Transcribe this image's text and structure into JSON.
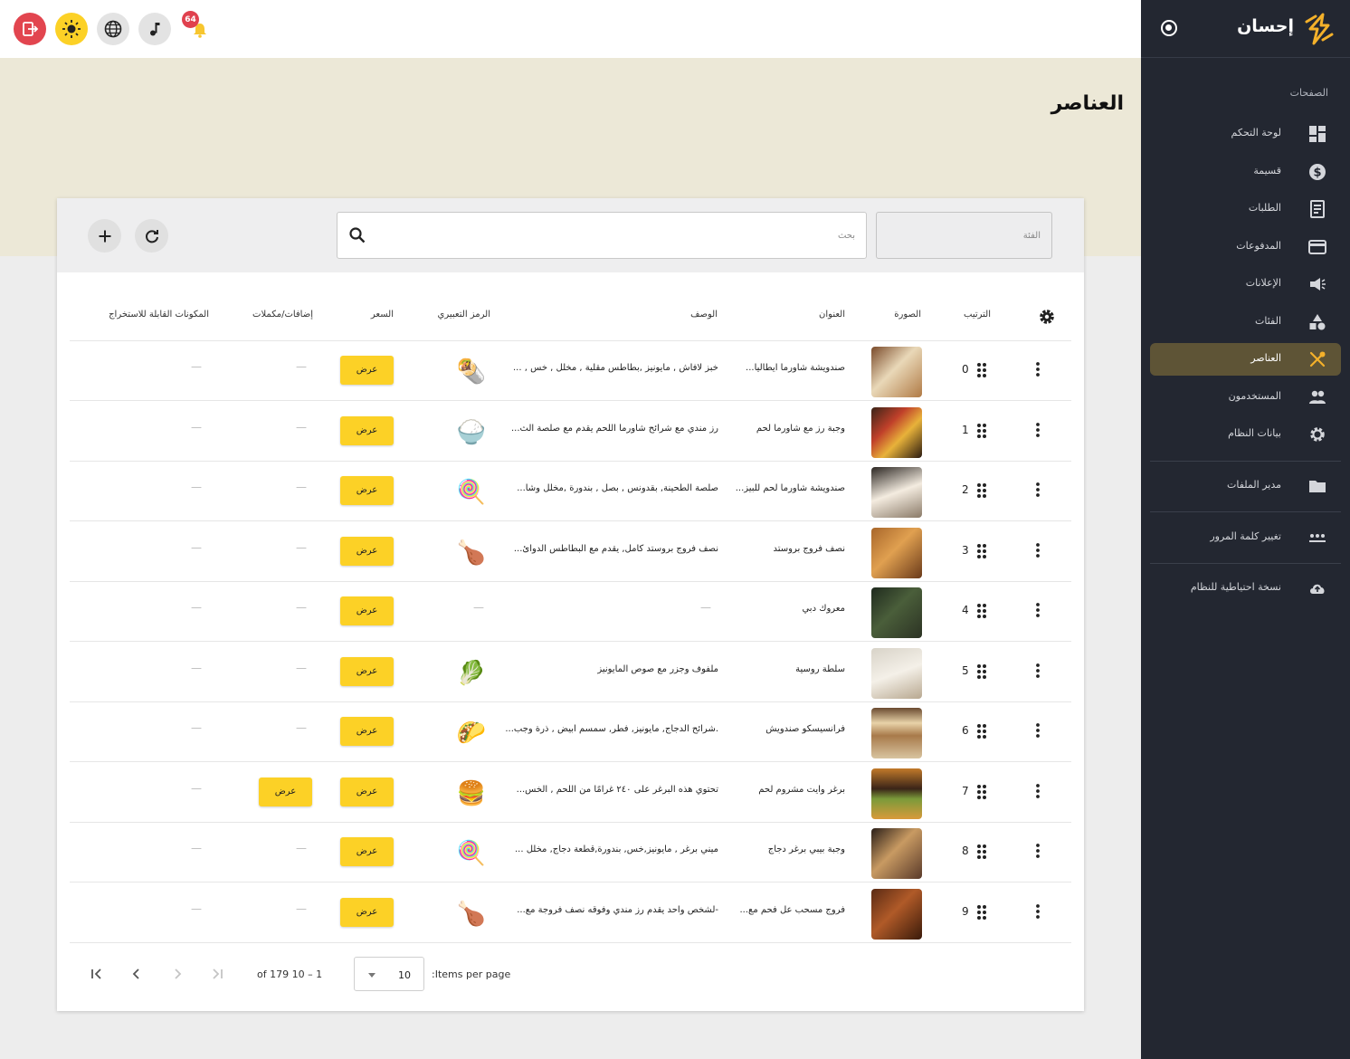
{
  "app": {
    "name": "إحسان"
  },
  "topbar": {
    "notification_count": "64",
    "buttons": [
      "logout-icon",
      "sun-icon",
      "globe-icon",
      "music-note-icon",
      "bell-icon"
    ]
  },
  "sidebar": {
    "section_title": "الصفحات",
    "items": [
      {
        "label": "لوحة التحكم",
        "icon": "dashboard-icon"
      },
      {
        "label": "قسيمة",
        "icon": "dollar-icon"
      },
      {
        "label": "الطلبات",
        "icon": "receipt-icon"
      },
      {
        "label": "المدفوعات",
        "icon": "credit-card-icon"
      },
      {
        "label": "الإعلانات",
        "icon": "megaphone-icon"
      },
      {
        "label": "الفئات",
        "icon": "category-icon"
      },
      {
        "label": "العناصر",
        "icon": "utensils-icon",
        "active": true
      },
      {
        "label": "المستخدمون",
        "icon": "users-icon"
      },
      {
        "label": "بيانات النظام",
        "icon": "gear-icon"
      }
    ],
    "file_manager": "مدير الملفات",
    "change_password": "تغيير كلمة المرور",
    "backup": "نسخة احتياطية للنظام"
  },
  "page": {
    "title": "العناصر"
  },
  "filters": {
    "search_placeholder": "بحث",
    "category_placeholder": "الفئة"
  },
  "table": {
    "headers": {
      "order": "الترتيب",
      "image": "الصورة",
      "title": "العنوان",
      "description": "الوصف",
      "emoji": "الرمز التعبيري",
      "price": "السعر",
      "addons": "إضافات/مكملات",
      "extractable": "المكونات القابلة للاستخراج"
    },
    "view_label": "عرض",
    "dash": "—",
    "rows": [
      {
        "order": "0",
        "title": "صندويشة شاورما ايطاليا...",
        "description": "خبز لافاش , مايونيز ,بطاطس مقلية , مخلل , خس , ...",
        "emoji": "🌯",
        "has_addons": false
      },
      {
        "order": "1",
        "title": "وجبة رز مع شاورما لحم",
        "description": "رز مندي مع شرائح شاورما اللحم يقدم مع صلصة الث...",
        "emoji": "🍚",
        "has_addons": false
      },
      {
        "order": "2",
        "title": "صندويشة شاورما لحم للبيز...",
        "description": "صلصة الطحينة, بقدونس , بصل , بندورة ,مخلل وشا...",
        "emoji": "🍭",
        "has_addons": false
      },
      {
        "order": "3",
        "title": "نصف فروج بروستد",
        "description": "نصف فروج بروستد كامل, يقدم مع البطاطس الدوائ...",
        "emoji": "🍗",
        "has_addons": false
      },
      {
        "order": "4",
        "title": "معروك دبي",
        "description": "",
        "emoji": "",
        "has_addons": false
      },
      {
        "order": "5",
        "title": "سلطة روسية",
        "description": "ملفوف وجزر مع صوص المايونيز",
        "emoji": "🥬",
        "has_addons": false
      },
      {
        "order": "6",
        "title": "فرانسيسكو صندويش",
        "description": ".شرائح الدجاج, مايونيز, فطر, سمسم ابيض , ذرة وجب...",
        "emoji": "🌮",
        "has_addons": false
      },
      {
        "order": "7",
        "title": "برغر وايت مشروم لحم",
        "description": "تحتوي هذه البرغر على ٢٤٠ غرامًا من اللحم , الخس...",
        "emoji": "🍔",
        "has_addons": true
      },
      {
        "order": "8",
        "title": "وجبة بيبي برغر دجاج",
        "description": "ميني برغر , مايونيز,خس, بندورة,قطعة دجاج, مخلل ...",
        "emoji": "🍭",
        "has_addons": false
      },
      {
        "order": "9",
        "title": "فروج مسحب عل فحم مع...",
        "description": "-لشخص واحد يقدم رز مندي وفوقه نصف فروجة مع...",
        "emoji": "🍗",
        "has_addons": false
      }
    ]
  },
  "paginator": {
    "items_per_page_label": ":Items per page",
    "page_size": "10",
    "range_label": "of 179 10 – 1"
  },
  "colors": {
    "sidebar_bg": "#232731",
    "active_item_bg": "#5e5436",
    "accent_yellow": "#fcd126",
    "header_band": "#ece8d7",
    "logout_red": "#e2454f"
  }
}
